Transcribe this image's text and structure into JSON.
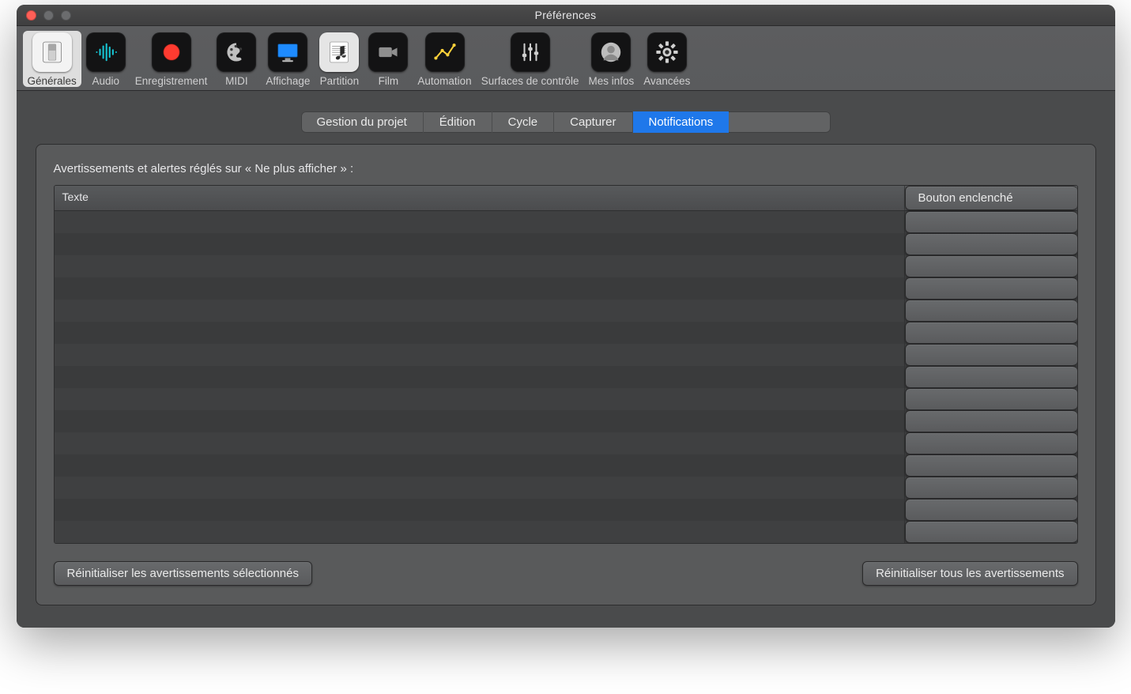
{
  "window": {
    "title": "Préférences"
  },
  "toolbar": {
    "items": [
      {
        "id": "generales",
        "label": "Générales",
        "icon": "switch-icon",
        "selected": true,
        "light": true
      },
      {
        "id": "audio",
        "label": "Audio",
        "icon": "waveform-icon"
      },
      {
        "id": "enregistrement",
        "label": "Enregistrement",
        "icon": "record-icon"
      },
      {
        "id": "midi",
        "label": "MIDI",
        "icon": "palette-icon"
      },
      {
        "id": "affichage",
        "label": "Affichage",
        "icon": "display-icon"
      },
      {
        "id": "partition",
        "label": "Partition",
        "icon": "score-icon",
        "light": true
      },
      {
        "id": "film",
        "label": "Film",
        "icon": "camera-icon"
      },
      {
        "id": "automation",
        "label": "Automation",
        "icon": "automation-icon"
      },
      {
        "id": "surfaces",
        "label": "Surfaces de contrôle",
        "icon": "sliders-icon"
      },
      {
        "id": "mesinfos",
        "label": "Mes infos",
        "icon": "user-icon"
      },
      {
        "id": "avancees",
        "label": "Avancées",
        "icon": "gear-icon"
      }
    ]
  },
  "tabs": {
    "items": [
      {
        "id": "gestion",
        "label": "Gestion du projet"
      },
      {
        "id": "edition",
        "label": "Édition"
      },
      {
        "id": "cycle",
        "label": "Cycle"
      },
      {
        "id": "capturer",
        "label": "Capturer"
      },
      {
        "id": "notifications",
        "label": "Notifications",
        "active": true
      }
    ]
  },
  "section": {
    "title": "Avertissements et alertes réglés sur « Ne plus afficher » :"
  },
  "table": {
    "columns": {
      "text": "Texte",
      "button": "Bouton enclenché"
    },
    "rows": []
  },
  "footer": {
    "reset_selected": "Réinitialiser les avertissements sélectionnés",
    "reset_all": "Réinitialiser tous les avertissements"
  },
  "colors": {
    "tab_selected": "#1f78ea",
    "close_red": "#ff5f57"
  }
}
